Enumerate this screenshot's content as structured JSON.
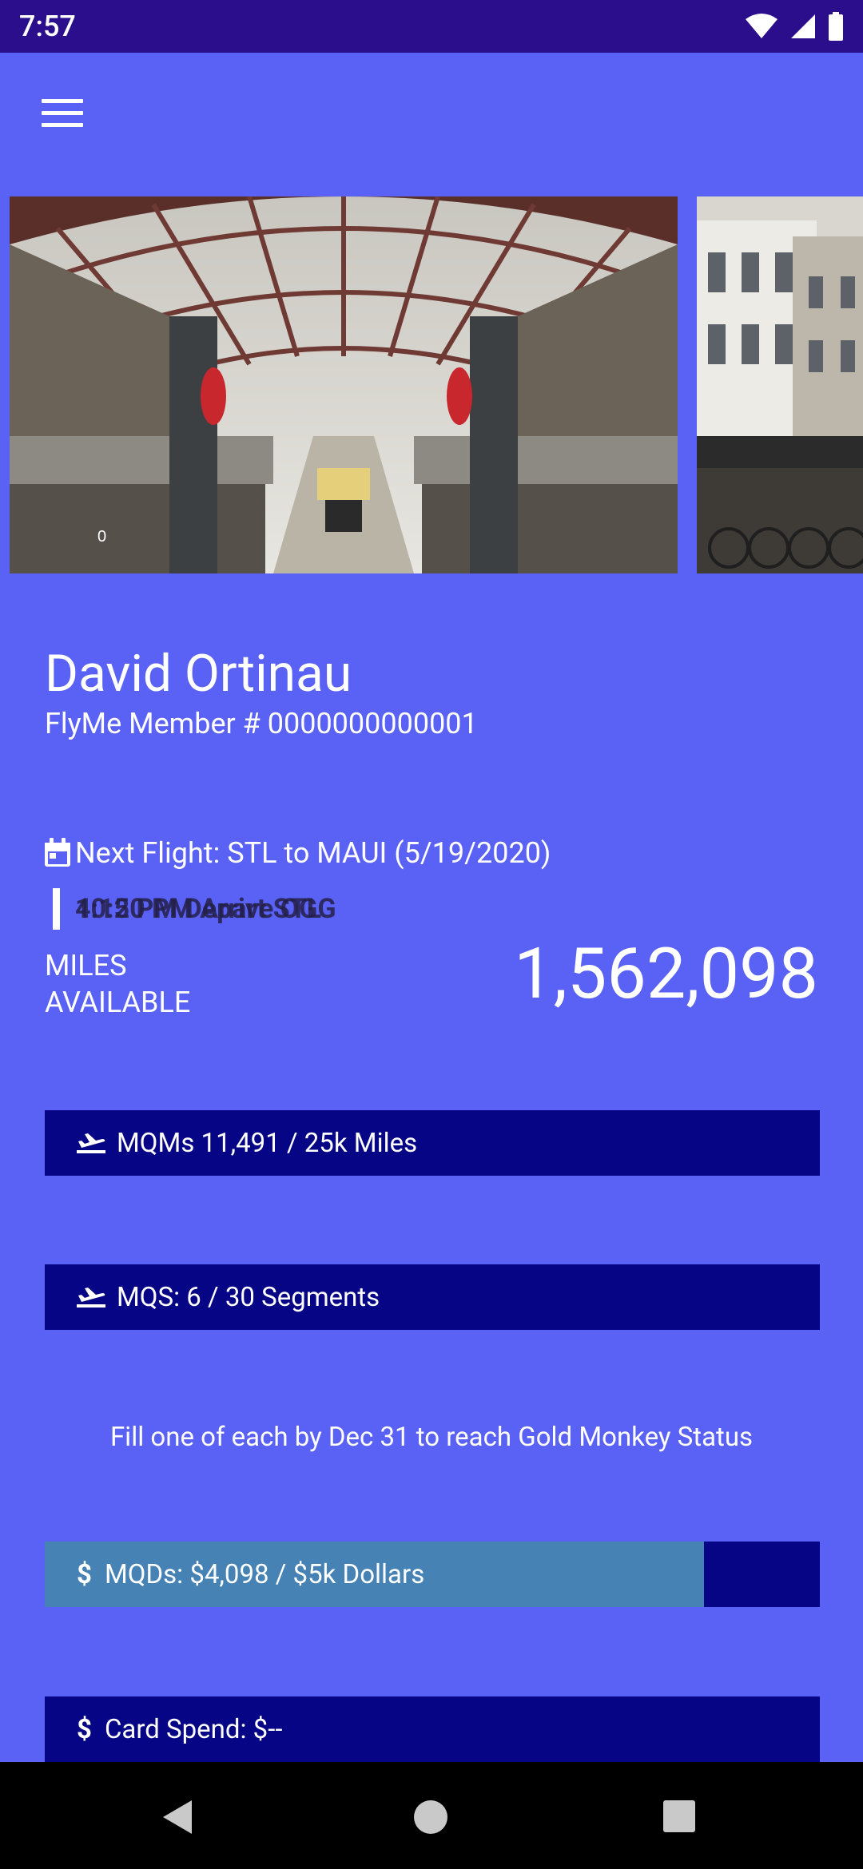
{
  "status_bar": {
    "time": "7:57"
  },
  "member": {
    "name": "David Ortinau",
    "number": "FlyMe Member # 0000000000001"
  },
  "next_flight": {
    "label": "Next Flight: STL to MAUI (5/19/2020)",
    "times_overlapping": [
      "4:15 PM Depart STL",
      "10:20 PM Arrive OGG"
    ]
  },
  "miles": {
    "label": "MILES\nAVAILABLE",
    "value": "1,562,098"
  },
  "progress": [
    {
      "label": "MQMs 11,491 / 25k Miles",
      "icon": "plane-icon",
      "fill": 0
    },
    {
      "label": "MQS: 6 / 30 Segments",
      "icon": "plane-icon",
      "fill": 0
    },
    {
      "label": "MQDs: $4,098 / $5k Dollars",
      "icon": "dollar-icon",
      "fill": 0.85
    },
    {
      "label": "Card Spend: $--",
      "icon": "dollar-icon",
      "fill": 0
    }
  ],
  "status_note": "Fill one of each by Dec 31 to reach Gold Monkey Status",
  "colors": {
    "background": "#5a62f5",
    "status_bar": "#2a0e8c",
    "progress_track": "#050585",
    "progress_fill": "#4682b4"
  }
}
